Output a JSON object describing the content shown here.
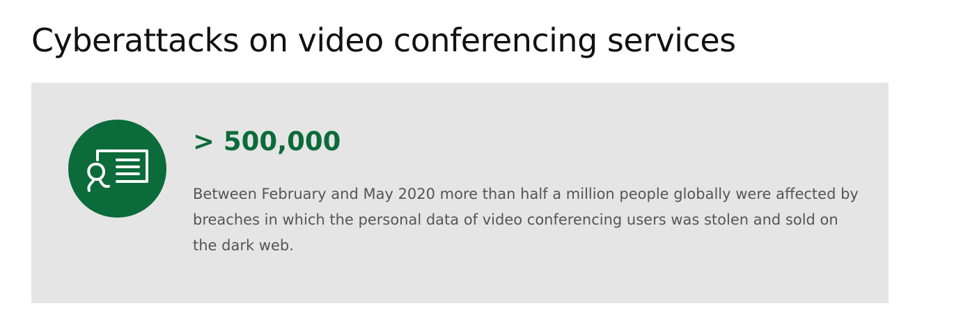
{
  "page": {
    "title": "Cyberattacks on video conferencing services"
  },
  "stat": {
    "value": "> 500,000",
    "description": "Between February and May 2020 more than half a million people globally were affected by breaches in which the personal data of video conferencing users was stolen and sold on the dark web.",
    "icon": "presenter-screen-icon"
  },
  "colors": {
    "accent": "#0b6b3a",
    "panel_background": "#e5e5e5",
    "title_text": "#111111",
    "body_text": "#555555"
  }
}
